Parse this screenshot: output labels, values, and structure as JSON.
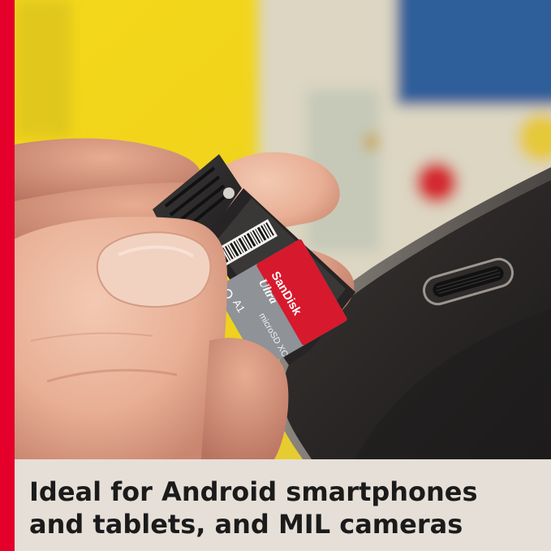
{
  "caption": {
    "line1": "Ideal for Android smartphones",
    "line2": "and tablets, and MIL cameras"
  },
  "card": {
    "brand": "SanDisk",
    "product": "Ultra",
    "capacity_class": "microSD XC",
    "speed_mark": "A1"
  },
  "colors": {
    "accent_stripe": "#e4002b",
    "caption_bg": "#e6dfd8",
    "caption_text": "#1b1b1b",
    "card_red": "#d7192d",
    "card_gray": "#8f9296"
  },
  "icons": {
    "speed_class": "uhs-class-icon"
  }
}
